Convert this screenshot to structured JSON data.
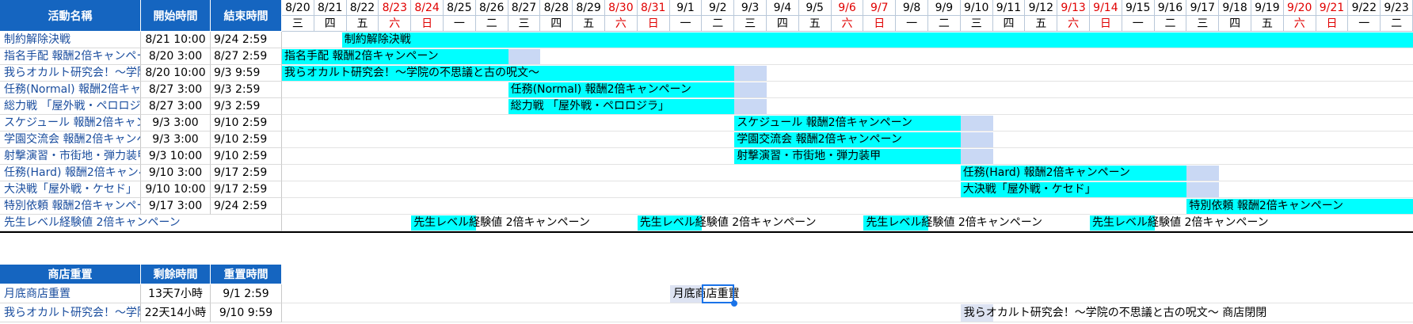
{
  "headers": {
    "event_name": "活動名稱",
    "start_time": "開始時間",
    "end_time": "結束時間",
    "shop_reset": "商店重置",
    "remaining": "剩餘時間",
    "reset_time": "重置時間"
  },
  "dates": [
    "8/20",
    "8/21",
    "8/22",
    "8/23",
    "8/24",
    "8/25",
    "8/26",
    "8/27",
    "8/28",
    "8/29",
    "8/30",
    "8/31",
    "9/1",
    "9/2",
    "9/3",
    "9/4",
    "9/5",
    "9/6",
    "9/7",
    "9/8",
    "9/9",
    "9/10",
    "9/11",
    "9/12",
    "9/13",
    "9/14",
    "9/15",
    "9/16",
    "9/17",
    "9/18",
    "9/19",
    "9/20",
    "9/21",
    "9/22",
    "9/23"
  ],
  "weekdays": [
    "三",
    "四",
    "五",
    "六",
    "日",
    "一",
    "二",
    "三",
    "四",
    "五",
    "六",
    "日",
    "一",
    "二",
    "三",
    "四",
    "五",
    "六",
    "日",
    "一",
    "二",
    "三",
    "四",
    "五",
    "六",
    "日",
    "一",
    "二",
    "三",
    "四",
    "五",
    "六",
    "日",
    "一",
    "二"
  ],
  "events": [
    {
      "name": "制約解除決戦",
      "start": "8/21  10:00",
      "end": "9/24  2:59",
      "label": "制約解除決戦",
      "bar_start": 1,
      "bar_end": 35,
      "tail": false
    },
    {
      "name": "指名手配 報酬2倍キャンペーン",
      "start": "8/20  3:00",
      "end": "8/27  2:59",
      "label": "指名手配 報酬2倍キャンペーン",
      "bar_start": 0,
      "bar_end": 7,
      "tail": true
    },
    {
      "name": "我らオカルト研究会！～学院の不思議と古の呪文～",
      "start": "8/20  10:00",
      "end": "9/3  9:59",
      "label": "我らオカルト研究会！～学院の不思議と古の呪文～",
      "bar_start": 0,
      "bar_end": 14,
      "tail": true
    },
    {
      "name": "任務(Normal) 報酬2倍キャンペーン",
      "start": "8/27  3:00",
      "end": "9/3  2:59",
      "label": "任務(Normal) 報酬2倍キャンペーン",
      "bar_start": 7,
      "bar_end": 14,
      "tail": true
    },
    {
      "name": "総力戦 「屋外戦・ペロロジラ」",
      "start": "8/27  3:00",
      "end": "9/3  2:59",
      "label": "総力戦 「屋外戦・ペロロジラ」",
      "bar_start": 7,
      "bar_end": 14,
      "tail": true
    },
    {
      "name": "スケジュール 報酬2倍キャンペーン",
      "start": "9/3  3:00",
      "end": "9/10  2:59",
      "label": "スケジュール 報酬2倍キャンペーン",
      "bar_start": 14,
      "bar_end": 21,
      "tail": true
    },
    {
      "name": "学園交流会 報酬2倍キャンペーン",
      "start": "9/3  3:00",
      "end": "9/10  2:59",
      "label": "学園交流会 報酬2倍キャンペーン",
      "bar_start": 14,
      "bar_end": 21,
      "tail": true
    },
    {
      "name": "射撃演習・市街地・弾力装甲",
      "start": "9/3  10:00",
      "end": "9/10 2:59",
      "label": "射撃演習・市街地・弾力装甲",
      "bar_start": 14,
      "bar_end": 21,
      "tail": true
    },
    {
      "name": "任務(Hard) 報酬2倍キャンペーン",
      "start": "9/10  3:00",
      "end": "9/17  2:59",
      "label": "任務(Hard) 報酬2倍キャンペーン",
      "bar_start": 21,
      "bar_end": 28,
      "tail": true
    },
    {
      "name": "大決戦「屋外戦・ケセド」",
      "start": "9/10  10:00",
      "end": "9/17  2:59",
      "label": "大決戦「屋外戦・ケセド」",
      "bar_start": 21,
      "bar_end": 28,
      "tail": true
    },
    {
      "name": "特別依頼 報酬2倍キャンペーン",
      "start": "9/17  3:00",
      "end": "9/24  2:59",
      "label": "特別依頼 報酬2倍キャンペーン",
      "bar_start": 28,
      "bar_end": 35,
      "tail": false
    }
  ],
  "exp_campaign": {
    "name": "先生レベル経験値 2倍キャンペーン",
    "label": "先生レベル経験値 2倍キャンペーン",
    "segments": [
      [
        4,
        6
      ],
      [
        11,
        13
      ],
      [
        18,
        20
      ],
      [
        25,
        27
      ]
    ]
  },
  "shops": [
    {
      "name": "月底商店重置",
      "remaining": "13天7小時",
      "reset": "9/1  2:59",
      "label": "月底商店重置",
      "col": 12
    },
    {
      "name": "我らオカルト研究会！～学院の不思議と古の呪文～",
      "remaining": "22天14小時",
      "reset": "9/10  9:59",
      "label": "我らオカルト研究会！～学院の不思議と古の呪文～ 商店閉閉",
      "col": 21
    }
  ],
  "colors": {
    "header_bg": "#1565c0",
    "bar": "#00ffff",
    "bar_tail": "#c9d8f4",
    "weekend_text": "#e00000",
    "name_text": "#1a4d9e"
  }
}
